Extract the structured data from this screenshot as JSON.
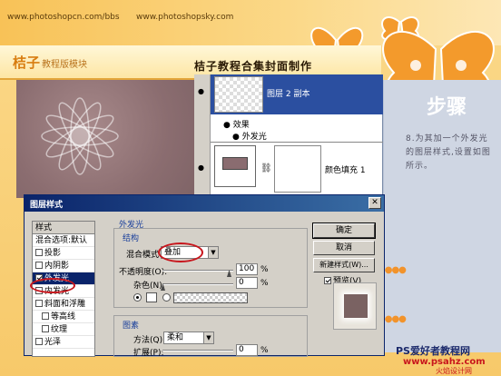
{
  "header": {
    "url_left": "www.photoshopcn.com/bbs",
    "url_right": "www.photoshopsky.com",
    "brand": "桔子",
    "brand_sub": "教程版模块",
    "page_title": "桔子教程合集封面制作"
  },
  "right_panel": {
    "step_label": "步骤",
    "instruction": "8.为其加一个外发光的图层样式,设置如图所示。"
  },
  "layers": {
    "layer_top": "图层 2 副本",
    "effects_label": "效果",
    "effect_item": "外发光",
    "layer_bottom": "颜色填充 1"
  },
  "dialog": {
    "title": "图层样式",
    "styles_header": "样式",
    "styles": [
      {
        "label": "混合选项:默认",
        "checkbox": false,
        "checked": false,
        "selected": false,
        "indent": false
      },
      {
        "label": "投影",
        "checkbox": true,
        "checked": false,
        "selected": false,
        "indent": false
      },
      {
        "label": "内阴影",
        "checkbox": true,
        "checked": false,
        "selected": false,
        "indent": false
      },
      {
        "label": "外发光",
        "checkbox": true,
        "checked": true,
        "selected": true,
        "indent": false
      },
      {
        "label": "内发光",
        "checkbox": true,
        "checked": false,
        "selected": false,
        "indent": false
      },
      {
        "label": "斜面和浮雕",
        "checkbox": true,
        "checked": false,
        "selected": false,
        "indent": false
      },
      {
        "label": "等高线",
        "checkbox": true,
        "checked": false,
        "selected": false,
        "indent": true
      },
      {
        "label": "纹理",
        "checkbox": true,
        "checked": false,
        "selected": false,
        "indent": true
      },
      {
        "label": "光泽",
        "checkbox": true,
        "checked": false,
        "selected": false,
        "indent": false
      }
    ],
    "panel_title": "外发光",
    "structure_title": "结构",
    "blend_mode_label": "混合模式",
    "blend_mode_value": "叠加",
    "opacity_label": "不透明度(O):",
    "opacity_value": "100",
    "opacity_unit": "%",
    "noise_label": "杂色(N):",
    "noise_value": "0",
    "noise_unit": "%",
    "elements_title": "图素",
    "method_label": "方法(Q):",
    "method_value": "柔和",
    "spread_label": "扩展(P):",
    "spread_value": "0",
    "spread_unit": "%",
    "ok_label": "确定",
    "cancel_label": "取消",
    "new_style_label": "新建样式(W)...",
    "preview_label": "预览(V)",
    "preview_checked": true
  },
  "watermark": {
    "line1": "PS爱好者教程网",
    "line2": "www.psahz.com",
    "line3": "火焰设计网"
  },
  "colors": {
    "accent_orange": "#f2932b",
    "selection_blue": "#0a246a",
    "ring_red": "#c8161d",
    "canvas_mauve": "#8b6d70"
  }
}
